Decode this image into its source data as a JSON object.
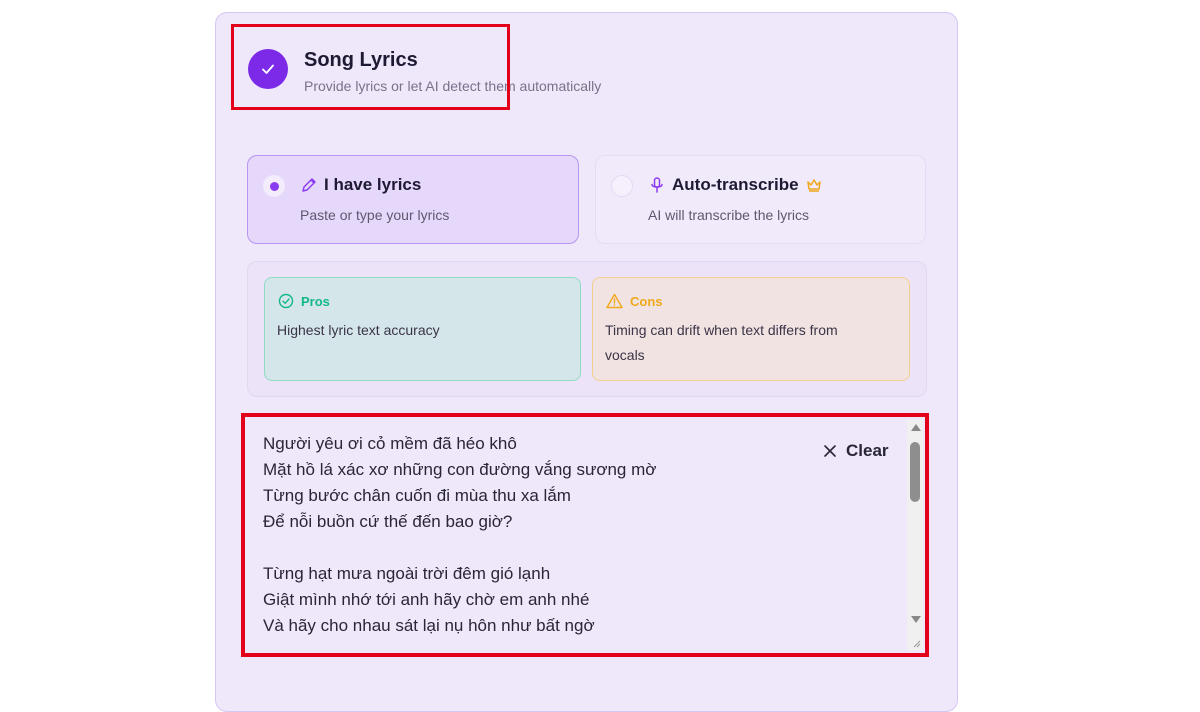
{
  "header": {
    "title": "Song Lyrics",
    "subtitle": "Provide lyrics or let AI detect them automatically",
    "check_icon": "check-icon"
  },
  "options": [
    {
      "label": "I have lyrics",
      "description": "Paste or type your lyrics",
      "icon": "pencil-icon",
      "selected": true
    },
    {
      "label": "Auto-transcribe",
      "description": "AI will transcribe the lyrics",
      "icon": "microphone-icon",
      "badge_icon": "crown-icon",
      "selected": false
    }
  ],
  "pros": {
    "heading": "Pros",
    "text": "Highest lyric text accuracy",
    "color": "#13b886"
  },
  "cons": {
    "heading": "Cons",
    "text_line1": "Timing can drift when text differs from",
    "text_line2": "vocals",
    "color": "#f0a81c"
  },
  "lyrics": {
    "lines": [
      "Người yêu ơi cỏ mềm đã héo khô",
      "Mặt hồ lá xác xơ những con đường vắng sương mờ",
      "Từng bước chân cuốn đi mùa thu xa lắm",
      "Để nỗi buồn cứ thế đến bao giờ?",
      "",
      "Từng hạt mưa ngoài trời đêm gió lạnh",
      "Giật mình nhớ tới anh hãy chờ em anh nhé",
      "Và hãy cho nhau sát lại nụ hôn như bất ngờ"
    ],
    "clear_label": "Clear"
  },
  "colors": {
    "accent": "#7c2ae8",
    "highlight": "#e3001b"
  }
}
